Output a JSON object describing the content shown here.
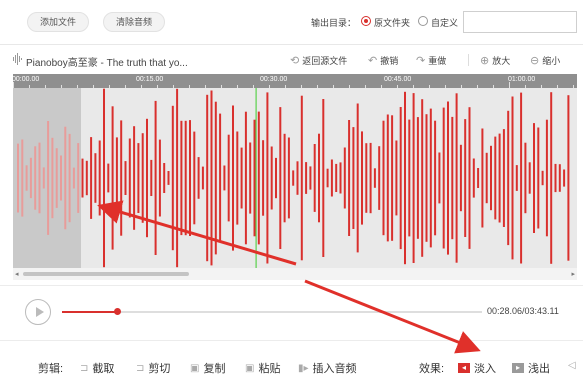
{
  "toolbar": {
    "add_file": "添加文件",
    "clear_audio": "清除音频",
    "output_label": "输出目录：",
    "option_original": "原文件夹",
    "option_custom": "自定义",
    "selected_option": "原文件夹",
    "path_value": ""
  },
  "track": {
    "title": "Pianoboy高至豪 - The truth that yo...",
    "icon": "audio-wave-icon",
    "tools": {
      "revert": "返回源文件",
      "undo": "撤销",
      "redo": "重做",
      "zoom_in": "放大",
      "zoom_out": "缩小"
    }
  },
  "timeline": {
    "ticks": [
      "00:00.00",
      "00:15.00",
      "00:30.00",
      "00:45.00",
      "01:00.00"
    ]
  },
  "waveform": {
    "selection_end_fraction": 0.12,
    "playhead_fraction": 0.43,
    "colors": {
      "active": "#d9302d",
      "selected": "#e89c9a",
      "playhead": "#59d14a"
    }
  },
  "player": {
    "time": "00:28.06/03:43.11",
    "progress_fraction": 0.13
  },
  "editbar": {
    "edit_label": "剪辑:",
    "crop": "截取",
    "cut": "剪切",
    "copy": "复制",
    "paste": "粘贴",
    "insert_audio": "插入音频",
    "effects_label": "效果:",
    "fade_in": "淡入",
    "fade_out": "浅出"
  },
  "colors": {
    "accent": "#d9302d",
    "annotation_arrow": "#e0302a"
  }
}
